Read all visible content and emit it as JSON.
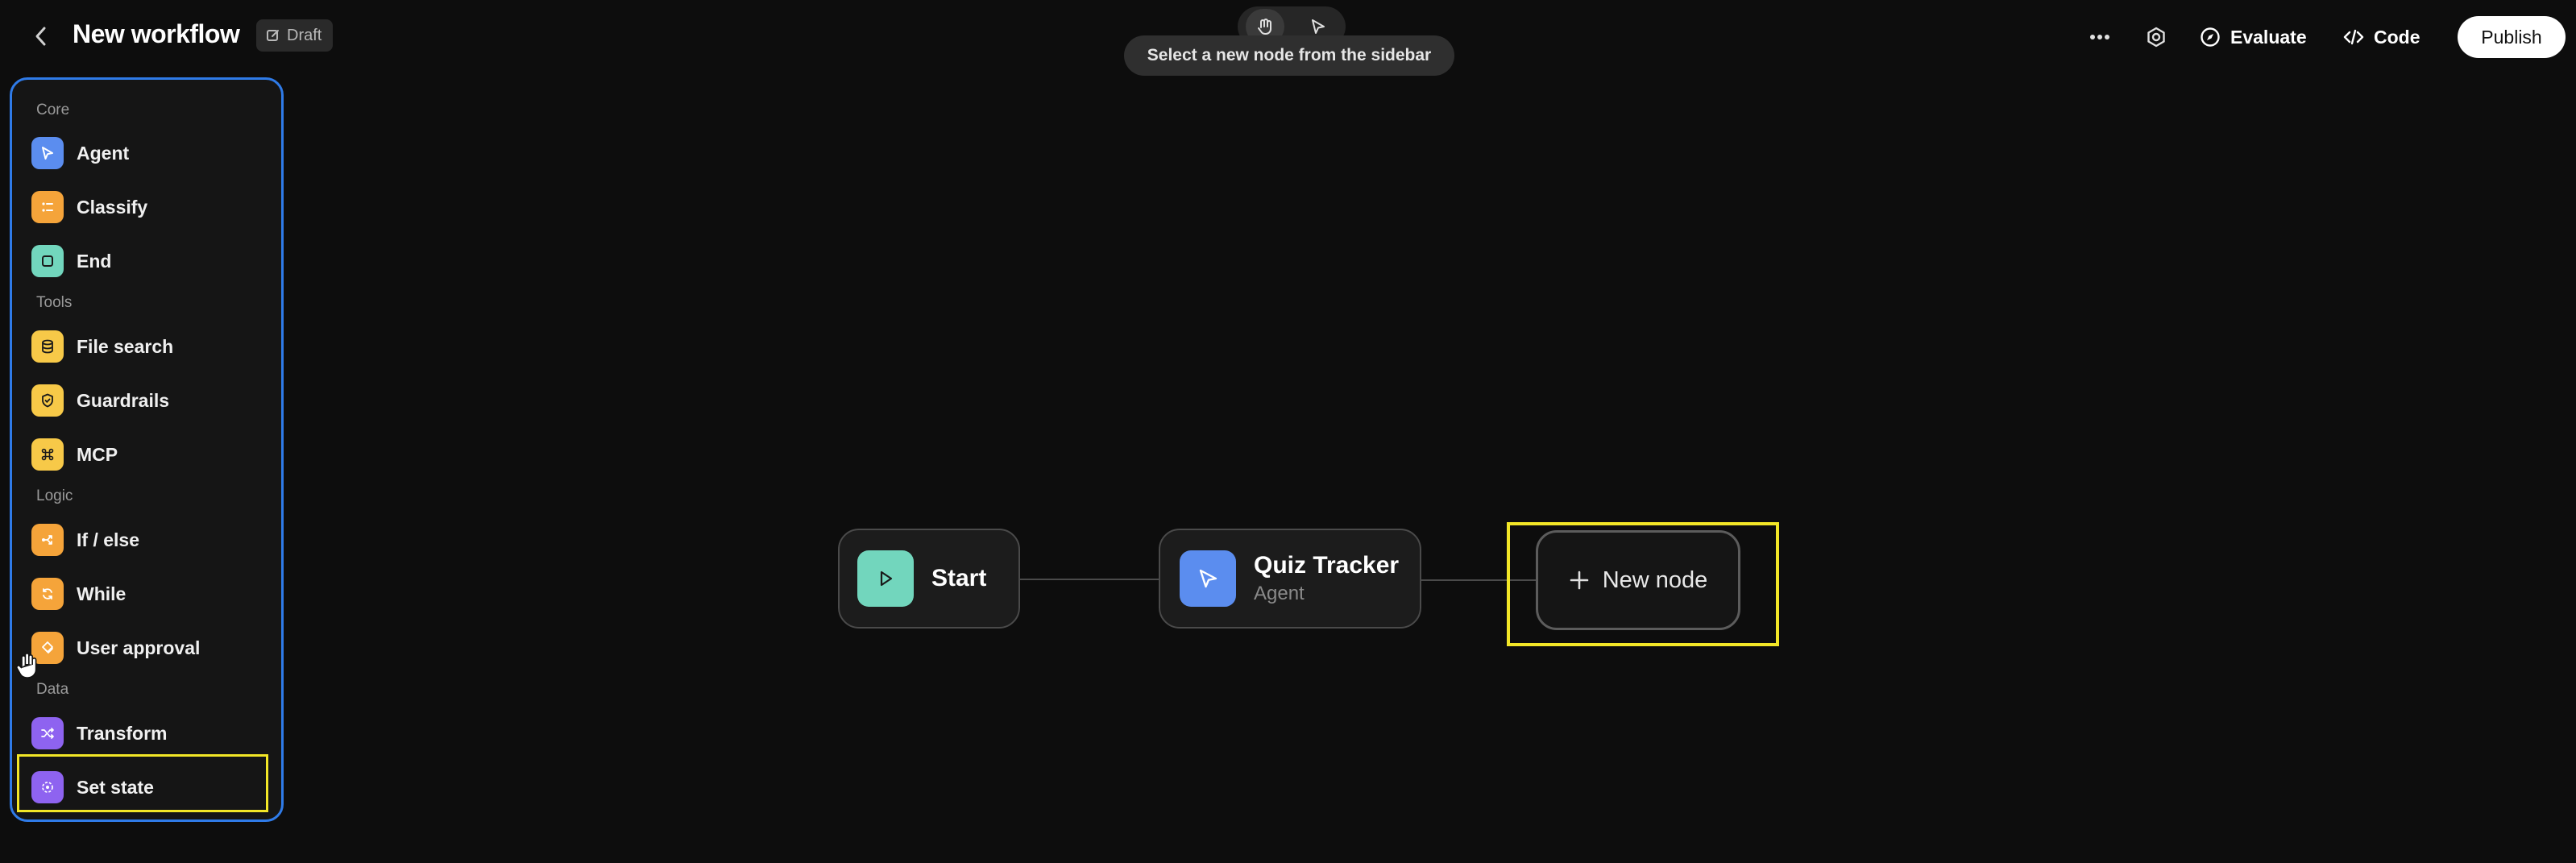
{
  "header": {
    "title": "New workflow",
    "draft_label": "Draft",
    "tooltip": "Select a new node from the sidebar",
    "evaluate_label": "Evaluate",
    "code_label": "Code",
    "publish_label": "Publish"
  },
  "sidebar": {
    "sections": [
      {
        "label": "Core",
        "items": [
          {
            "label": "Agent",
            "icon": "cursor-arrow-icon",
            "color": "#5b8def"
          },
          {
            "label": "Classify",
            "icon": "list-icon",
            "color": "#f5a43a"
          },
          {
            "label": "End",
            "icon": "stop-square-icon",
            "color": "#72d6bd"
          }
        ]
      },
      {
        "label": "Tools",
        "items": [
          {
            "label": "File search",
            "icon": "database-icon",
            "color": "#f7c948"
          },
          {
            "label": "Guardrails",
            "icon": "shield-icon",
            "color": "#f7c948"
          },
          {
            "label": "MCP",
            "icon": "command-icon",
            "color": "#f7c948"
          }
        ]
      },
      {
        "label": "Logic",
        "items": [
          {
            "label": "If / else",
            "icon": "branch-icon",
            "color": "#f5a43a"
          },
          {
            "label": "While",
            "icon": "loop-icon",
            "color": "#f5a43a"
          },
          {
            "label": "User approval",
            "icon": "approval-icon",
            "color": "#f5a43a"
          }
        ]
      },
      {
        "label": "Data",
        "items": [
          {
            "label": "Transform",
            "icon": "shuffle-icon",
            "color": "#8e63f0"
          },
          {
            "label": "Set state",
            "icon": "state-icon",
            "color": "#8e63f0"
          }
        ]
      }
    ]
  },
  "canvas": {
    "nodes": [
      {
        "title": "Start",
        "icon": "play-icon",
        "color": "#72d6bd"
      },
      {
        "title": "Quiz Tracker",
        "subtitle": "Agent",
        "icon": "cursor-arrow-icon",
        "color": "#5b8def"
      }
    ],
    "new_node_label": "New node"
  }
}
